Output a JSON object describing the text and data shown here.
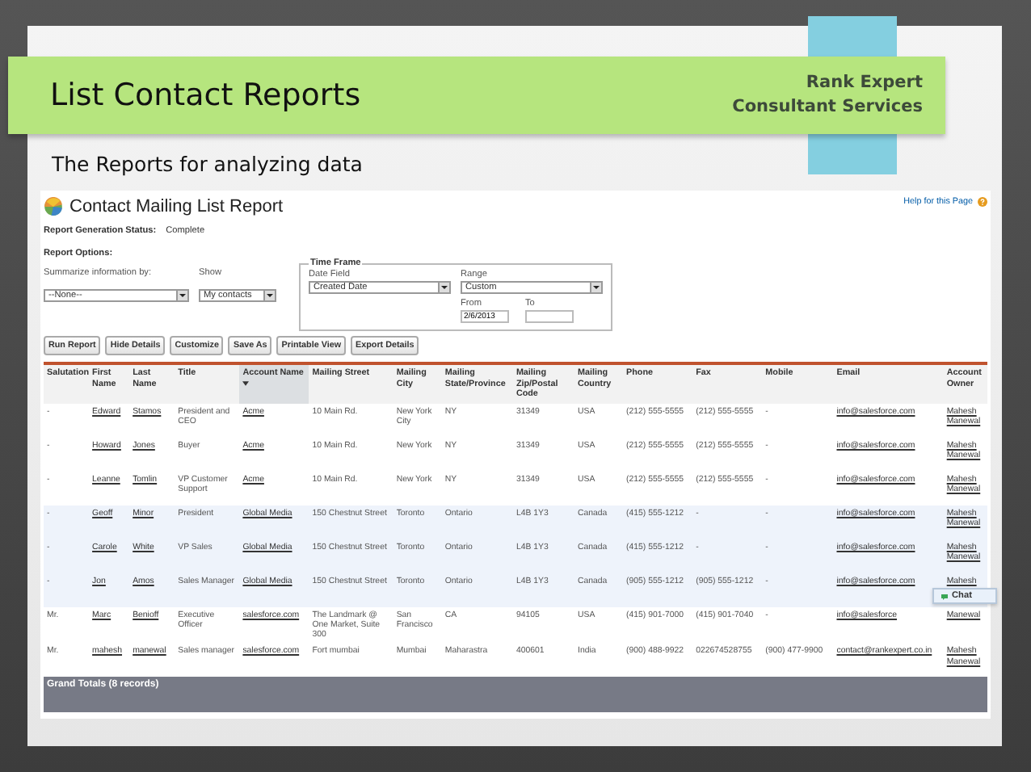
{
  "slide": {
    "title": "List Contact Reports",
    "company": [
      "Rank Expert",
      "Consultant Services"
    ],
    "subtitle": "The Reports for analyzing data"
  },
  "report": {
    "title": "Contact Mailing List Report",
    "help_link": "Help for this Page",
    "status_label": "Report Generation Status:",
    "status_value": "Complete",
    "options_label": "Report Options:",
    "summarize": {
      "label": "Summarize information by:",
      "value": "--None--"
    },
    "show": {
      "label": "Show",
      "value": "My contacts"
    },
    "time_frame": {
      "legend": "Time Frame",
      "date_field": {
        "label": "Date Field",
        "value": "Created Date"
      },
      "range": {
        "label": "Range",
        "value": "Custom"
      },
      "from": {
        "label": "From",
        "value": "2/6/2013"
      },
      "to": {
        "label": "To"
      }
    },
    "buttons": [
      "Run Report",
      "Hide Details",
      "Customize",
      "Save As",
      "Printable View",
      "Export Details"
    ],
    "table": {
      "columns": [
        {
          "label": "Salutation",
          "link": false,
          "sorted": false
        },
        {
          "label": "First Name",
          "link": true,
          "sorted": false
        },
        {
          "label": "Last Name",
          "link": true,
          "sorted": false
        },
        {
          "label": "Title",
          "link": false,
          "sorted": false
        },
        {
          "label": "Account Name",
          "link": true,
          "sorted": true
        },
        {
          "label": "Mailing Street",
          "link": false,
          "sorted": false
        },
        {
          "label": "Mailing City",
          "link": false,
          "sorted": false
        },
        {
          "label": "Mailing State/Province",
          "link": false,
          "sorted": false
        },
        {
          "label": "Mailing Zip/Postal Code",
          "link": false,
          "sorted": false
        },
        {
          "label": "Mailing Country",
          "link": false,
          "sorted": false
        },
        {
          "label": "Phone",
          "link": false,
          "sorted": false
        },
        {
          "label": "Fax",
          "link": false,
          "sorted": false
        },
        {
          "label": "Mobile",
          "link": false,
          "sorted": false
        },
        {
          "label": "Email",
          "link": true,
          "sorted": false
        },
        {
          "label": "Account Owner",
          "link": true,
          "sorted": false
        }
      ],
      "rows": [
        {
          "highlighted": false,
          "cells": [
            "-",
            "Edward",
            "Stamos",
            "President and CEO",
            "Acme",
            "10 Main Rd.",
            "New York City",
            "NY",
            "31349",
            "USA",
            "(212) 555-5555",
            "(212) 555-5555",
            "-",
            "info@salesforce.com",
            "Mahesh Manewal"
          ]
        },
        {
          "highlighted": false,
          "cells": [
            "-",
            "Howard",
            "Jones",
            "Buyer",
            "Acme",
            "10 Main Rd.",
            "New York",
            "NY",
            "31349",
            "USA",
            "(212) 555-5555",
            "(212) 555-5555",
            "-",
            "info@salesforce.com",
            "Mahesh Manewal"
          ]
        },
        {
          "highlighted": false,
          "cells": [
            "-",
            "Leanne",
            "Tomlin",
            "VP Customer Support",
            "Acme",
            "10 Main Rd.",
            "New York",
            "NY",
            "31349",
            "USA",
            "(212) 555-5555",
            "(212) 555-5555",
            "-",
            "info@salesforce.com",
            "Mahesh Manewal"
          ]
        },
        {
          "highlighted": true,
          "cells": [
            "-",
            "Geoff",
            "Minor",
            "President",
            "Global Media",
            "150 Chestnut Street",
            "Toronto",
            "Ontario",
            "L4B 1Y3",
            "Canada",
            "(415) 555-1212",
            "-",
            "-",
            "info@salesforce.com",
            "Mahesh Manewal"
          ]
        },
        {
          "highlighted": true,
          "cells": [
            "-",
            "Carole",
            "White",
            "VP Sales",
            "Global Media",
            "150 Chestnut Street",
            "Toronto",
            "Ontario",
            "L4B 1Y3",
            "Canada",
            "(415) 555-1212",
            "-",
            "-",
            "info@salesforce.com",
            "Mahesh Manewal"
          ]
        },
        {
          "highlighted": true,
          "cells": [
            "-",
            "Jon",
            "Amos",
            "Sales Manager",
            "Global Media",
            "150 Chestnut Street",
            "Toronto",
            "Ontario",
            "L4B 1Y3",
            "Canada",
            "(905) 555-1212",
            "(905) 555-1212",
            "-",
            "info@salesforce.com",
            "Mahesh"
          ]
        },
        {
          "highlighted": false,
          "cells": [
            "Mr.",
            "Marc",
            "Benioff",
            "Executive Officer",
            "salesforce.com",
            "The Landmark @ One Market, Suite 300",
            "San Francisco",
            "CA",
            "94105",
            "USA",
            "(415) 901-7000",
            "(415) 901-7040",
            "-",
            "info@salesforce",
            "Manewal"
          ]
        },
        {
          "highlighted": false,
          "cells": [
            "Mr.",
            "mahesh",
            "manewal",
            "Sales manager",
            "salesforce.com",
            "Fort mumbai",
            "Mumbai",
            "Maharastra",
            "400601",
            "India",
            "(900) 488-9922",
            "022674528755",
            "(900) 477-9900",
            "contact@rankexpert.co.in",
            "Mahesh Manewal"
          ]
        }
      ]
    },
    "grand_total": "Grand Totals (8 records)",
    "chat": {
      "label": "Chat"
    }
  }
}
